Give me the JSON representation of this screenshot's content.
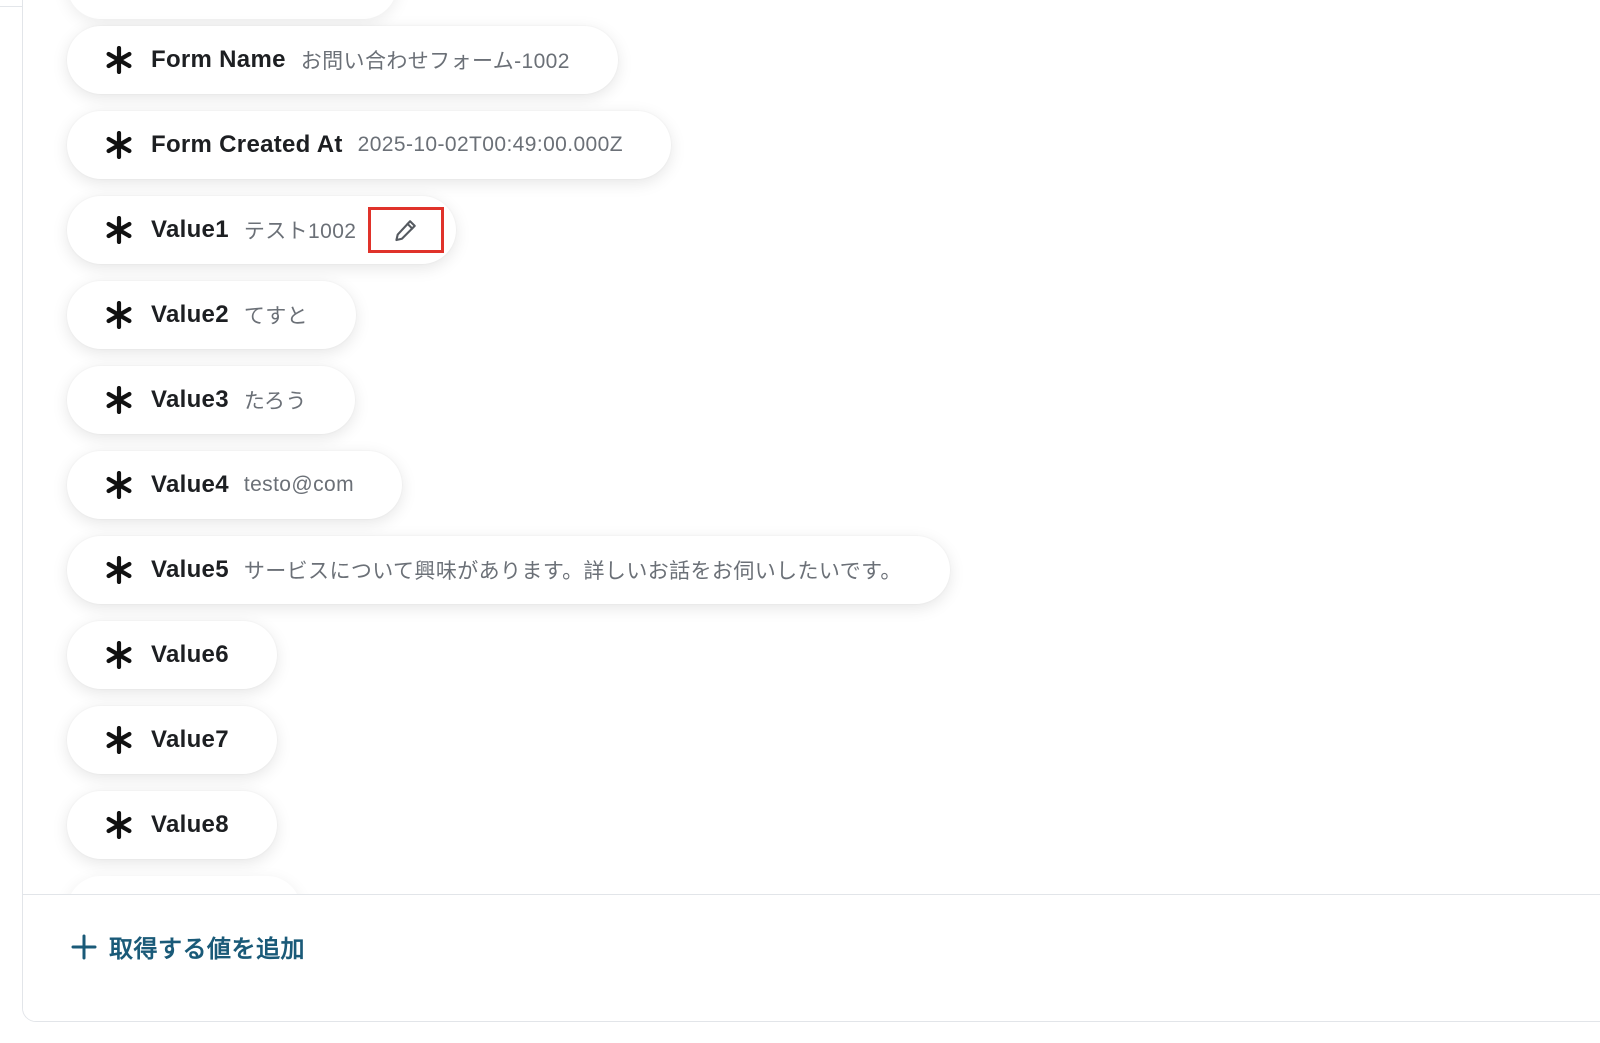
{
  "fields": [
    {
      "name": "Form Name",
      "value": "お問い合わせフォーム-1002",
      "icon": "asterisk-icon"
    },
    {
      "name": "Form Created At",
      "value": "2025-10-02T00:49:00.000Z",
      "icon": "asterisk-icon"
    },
    {
      "name": "Value1",
      "value": "テスト1002",
      "icon": "asterisk-icon",
      "editable": true
    },
    {
      "name": "Value2",
      "value": "てすと",
      "icon": "asterisk-icon"
    },
    {
      "name": "Value3",
      "value": "たろう",
      "icon": "asterisk-icon"
    },
    {
      "name": "Value4",
      "value": "testo@com",
      "icon": "asterisk-icon"
    },
    {
      "name": "Value5",
      "value": "サービスについて興味があります。詳しいお話をお伺いしたいです。",
      "icon": "asterisk-icon"
    },
    {
      "name": "Value6",
      "value": "",
      "icon": "asterisk-icon"
    },
    {
      "name": "Value7",
      "value": "",
      "icon": "asterisk-icon"
    },
    {
      "name": "Value8",
      "value": "",
      "icon": "asterisk-icon"
    }
  ],
  "edit_icon": "pencil-icon",
  "highlight_color": "#e0322a",
  "footer": {
    "add_label": "取得する値を追加",
    "add_icon": "plus-icon",
    "accent_color": "#1a5a78"
  }
}
